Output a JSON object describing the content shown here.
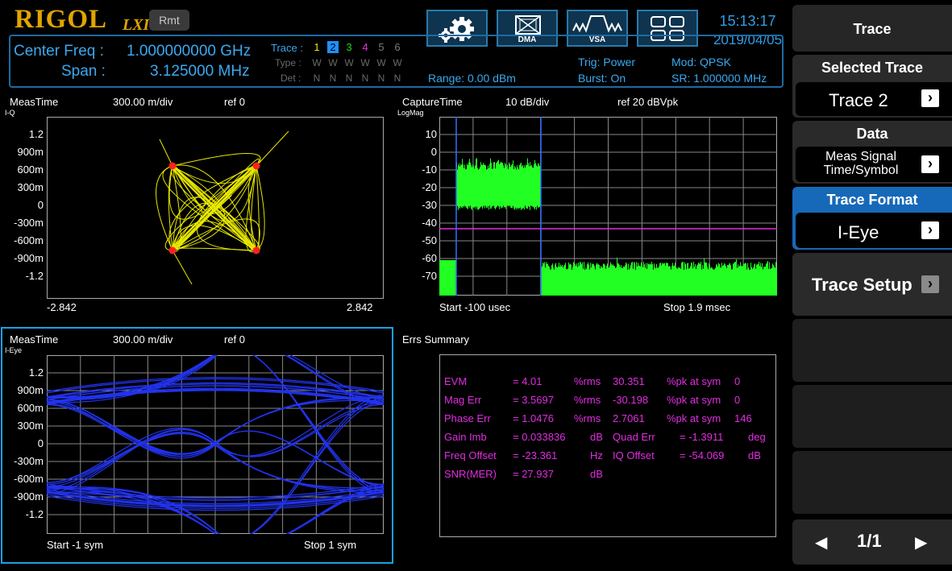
{
  "header": {
    "logo": "RIGOL",
    "lxi": "LXI",
    "rmt": "Rmt",
    "toolbar": [
      {
        "label": "",
        "icon": "gear-icon"
      },
      {
        "label": "DMA",
        "icon": "dma-icon"
      },
      {
        "label": "VSA",
        "icon": "vsa-icon"
      },
      {
        "label": "",
        "icon": "layout-icon"
      }
    ],
    "time": "15:13:17",
    "date": "2019/04/05"
  },
  "info": {
    "center_freq_label": "Center Freq :",
    "center_freq_value": "1.000000000 GHz",
    "span_label": "Span :",
    "span_value": "3.125000 MHz",
    "trace_label": "Trace :",
    "type_label": "Type :",
    "det_label": "Det :",
    "trace_numbers": [
      "1",
      "2",
      "3",
      "4",
      "5",
      "6"
    ],
    "trace_colors": [
      "#e6e600",
      "#1e8fff",
      "#1ed81e",
      "#e02ee0",
      "#7a7a7a",
      "#7a7a7a"
    ],
    "types": [
      "W",
      "W",
      "W",
      "W",
      "W",
      "W"
    ],
    "dets": [
      "N",
      "N",
      "N",
      "N",
      "N",
      "N"
    ],
    "range": "Range: 0.00 dBm",
    "trig": "Trig: Power",
    "burst": "Burst: On",
    "mod": "Mod: QPSK",
    "sr": "SR: 1.000000 MHz"
  },
  "iq_plot": {
    "title": "MeasTime",
    "scale": "300.00 m/div",
    "ref": "ref 0",
    "corner": "I-Q",
    "yticks": [
      "1.2",
      "900m",
      "600m",
      "300m",
      "0",
      "-300m",
      "-600m",
      "-900m",
      "-1.2"
    ],
    "xmin": "-2.842",
    "xmax": "2.842"
  },
  "spectrum_plot": {
    "title": "CaptureTime",
    "scale": "10 dB/div",
    "ref": "ref 20 dBVpk",
    "corner": "LogMag",
    "yticks": [
      "10",
      "0",
      "-10",
      "-20",
      "-30",
      "-40",
      "-50",
      "-60",
      "-70"
    ],
    "start": "Start -100 usec",
    "stop": "Stop 1.9 msec"
  },
  "eye_plot": {
    "title": "MeasTime",
    "scale": "300.00 m/div",
    "ref": "ref 0",
    "corner": "I-Eye",
    "yticks": [
      "1.2",
      "900m",
      "600m",
      "300m",
      "0",
      "-300m",
      "-600m",
      "-900m",
      "-1.2"
    ],
    "start": "Start -1 sym",
    "stop": "Stop 1 sym"
  },
  "errs": {
    "title": "Errs Summary",
    "rows": [
      [
        "EVM",
        "= 4.01",
        "%rms",
        "30.351",
        "%pk at sym",
        "0"
      ],
      [
        "Mag Err",
        "= 3.5697",
        "%rms",
        "-30.198",
        "%pk at sym",
        "0"
      ],
      [
        "Phase Err",
        "= 1.0476",
        "%rms",
        "2.7061",
        "%pk at sym",
        "146"
      ],
      [
        "Gain Imb",
        "= 0.033836",
        "dB",
        "Quad Err",
        "= -1.3911",
        "deg"
      ],
      [
        "Freq Offset",
        "= -23.361",
        "Hz",
        "IQ Offset",
        "= -54.069",
        "dB"
      ],
      [
        "SNR(MER)",
        "= 27.937",
        "dB",
        "",
        "",
        ""
      ]
    ]
  },
  "menu": {
    "title": "Trace",
    "selected_trace_label": "Selected Trace",
    "selected_trace_value": "Trace 2",
    "data_label": "Data",
    "data_value_1": "Meas Signal",
    "data_value_2": "Time/Symbol",
    "trace_format_label": "Trace Format",
    "trace_format_value": "I-Eye",
    "trace_setup": "Trace Setup",
    "page": "1/1"
  }
}
